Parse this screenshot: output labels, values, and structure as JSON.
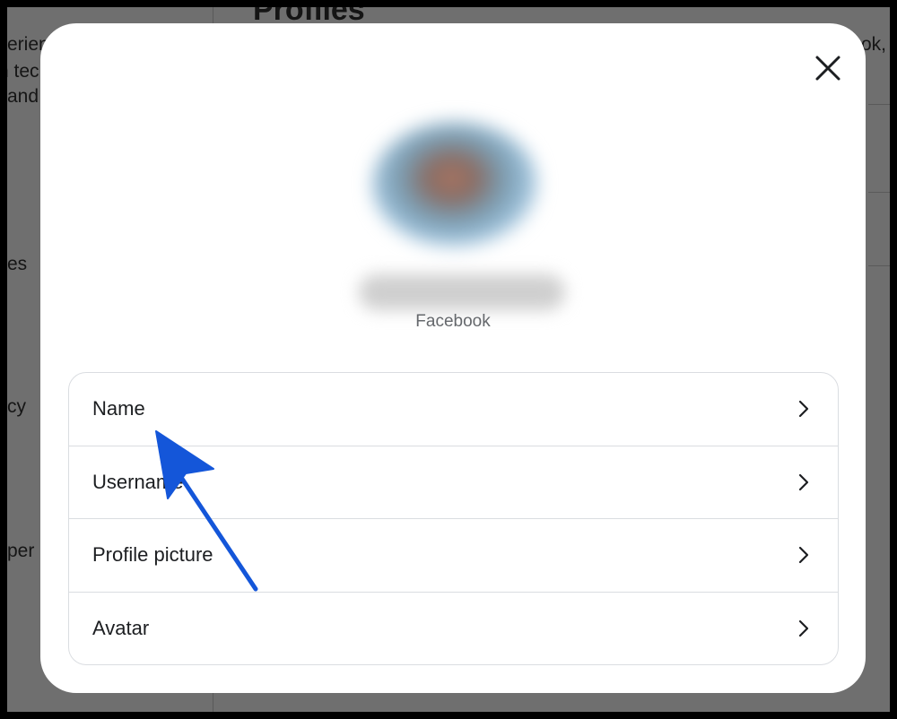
{
  "background": {
    "title": "Profiles",
    "fragments": [
      "erien",
      "n tec",
      "and",
      "es",
      "cy",
      "per",
      "ok,"
    ]
  },
  "modal": {
    "platform": "Facebook",
    "close_icon": "close-icon",
    "items": [
      {
        "label": "Name"
      },
      {
        "label": "Username"
      },
      {
        "label": "Profile picture"
      },
      {
        "label": "Avatar"
      }
    ]
  },
  "annotation": {
    "arrow_color": "#1456d9"
  }
}
